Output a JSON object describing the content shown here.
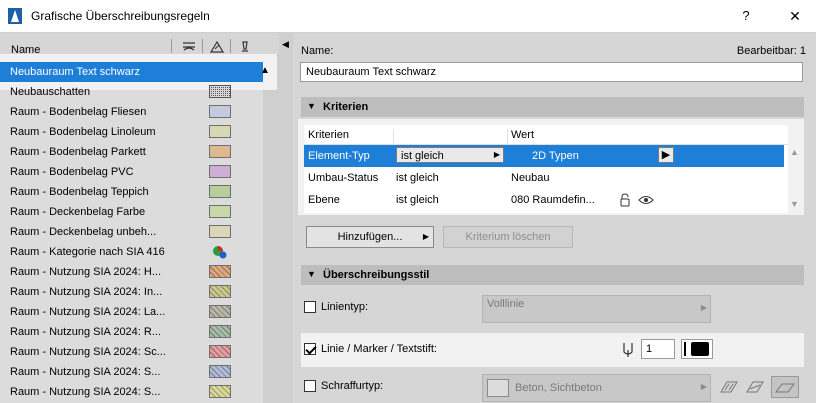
{
  "window": {
    "title": "Grafische Überschreibungsregeln",
    "help": "?",
    "close": "✕"
  },
  "left": {
    "header": {
      "name": "Name"
    },
    "rows": [
      {
        "label": "Neubauraum Text schwarz",
        "selected": true,
        "swatch": ""
      },
      {
        "label": "Neubauschatten",
        "swatch": "#d0d0d0"
      },
      {
        "label": "Raum - Bodenbelag Fliesen",
        "swatch": "#c4cbe0"
      },
      {
        "label": "Raum - Bodenbelag Linoleum",
        "swatch": "#d6d8b4"
      },
      {
        "label": "Raum - Bodenbelag Parkett",
        "swatch": "#e0b890"
      },
      {
        "label": "Raum - Bodenbelag PVC",
        "swatch": "#cfaed6"
      },
      {
        "label": "Raum - Bodenbelag Teppich",
        "swatch": "#b7cf9b"
      },
      {
        "label": "Raum - Deckenbelag Farbe",
        "swatch": "#c8d8a8"
      },
      {
        "label": "Raum - Deckenbelag unbeh...",
        "swatch": "#dcd6b8"
      },
      {
        "label": "Raum - Kategorie nach SIA 416",
        "swatch": ""
      },
      {
        "label": "Raum - Nutzung SIA 2024: H...",
        "swatch": "#e0a880"
      },
      {
        "label": "Raum - Nutzung SIA 2024: In...",
        "swatch": "#c8c890"
      },
      {
        "label": "Raum - Nutzung SIA 2024: La...",
        "swatch": "#b8b8a8"
      },
      {
        "label": "Raum - Nutzung SIA 2024: R...",
        "swatch": "#a8bca8"
      },
      {
        "label": "Raum - Nutzung SIA 2024: Sc...",
        "swatch": "#e0a0a0"
      },
      {
        "label": "Raum - Nutzung SIA 2024: S...",
        "swatch": "#b0bcd8"
      },
      {
        "label": "Raum - Nutzung SIA 2024: S...",
        "swatch": "#d8d89c"
      }
    ]
  },
  "right": {
    "name_label": "Name:",
    "editable_label": "Bearbeitbar: 1",
    "name_value": "Neubauraum Text schwarz",
    "criteria": {
      "section_title": "Kriterien",
      "columns": [
        "Kriterien",
        "Wert"
      ],
      "rows": [
        {
          "criterion": "Element-Typ",
          "operator": "ist gleich",
          "value": "2D Typen",
          "selected": true
        },
        {
          "criterion": "Umbau-Status",
          "operator": "ist gleich",
          "value": "Neubau"
        },
        {
          "criterion": "Ebene",
          "operator": "ist gleich",
          "value": "080 Raumdefin..."
        }
      ],
      "add_button": "Hinzufügen...",
      "remove_button": "Kriterium löschen"
    },
    "style": {
      "section_title": "Überschreibungsstil",
      "linetype": {
        "label": "Linientyp:",
        "checked": false,
        "value": "Volllinie"
      },
      "pen": {
        "label": "Linie / Marker / Textstift:",
        "checked": true,
        "value": "1"
      },
      "fill": {
        "label": "Schraffurtyp:",
        "checked": false,
        "value": "Beton, Sichtbeton"
      }
    }
  },
  "colors": {
    "selection": "#1e7fd8",
    "panel": "#d6d6d6",
    "highlight": "#f2f2f2"
  }
}
